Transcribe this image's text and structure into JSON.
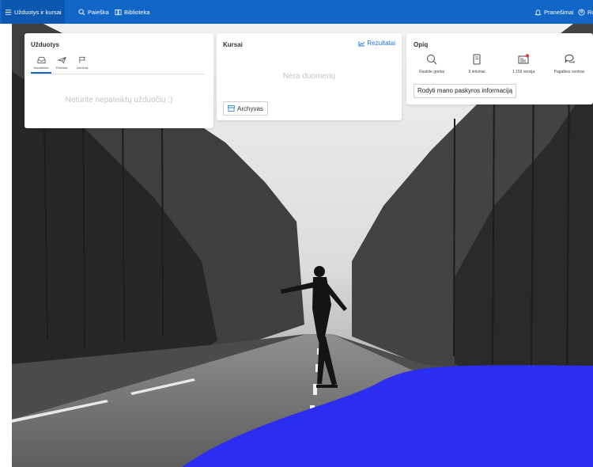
{
  "nav": {
    "tasks_label": "Užduotys ir kursai",
    "search_label": "Paieška",
    "library_label": "Biblioteka",
    "notifications_label": "Pranešimai",
    "profile_label": "Ro"
  },
  "tasks_card": {
    "title": "Užduotys",
    "tabs": [
      {
        "label": "Nepateikta",
        "icon": "tray-icon"
      },
      {
        "label": "Pateikta",
        "icon": "paper-plane-icon"
      },
      {
        "label": "Ivertinta",
        "icon": "flag-icon"
      }
    ],
    "empty_text": "Neturite nepateiktų užduočių :)"
  },
  "courses_card": {
    "title": "Kursai",
    "results_label": "Rezultatai",
    "empty_text": "Nėra duomenų",
    "archive_label": "Archyvas"
  },
  "options_card": {
    "title": "Opiq",
    "items": [
      {
        "label": "Raskite greitai",
        "icon": "search-icon"
      },
      {
        "label": "9 rinkiniai",
        "icon": "book-icon"
      },
      {
        "label": "1.159 versija",
        "icon": "news-icon"
      },
      {
        "label": "Pagalbos centras",
        "icon": "chat-icon"
      }
    ],
    "account_button": "Rodyti mano paskyros informaciją"
  },
  "colors": {
    "topbar": "#1166c8",
    "accent": "#1a73e8",
    "blue_shape": "#2b2df0"
  }
}
